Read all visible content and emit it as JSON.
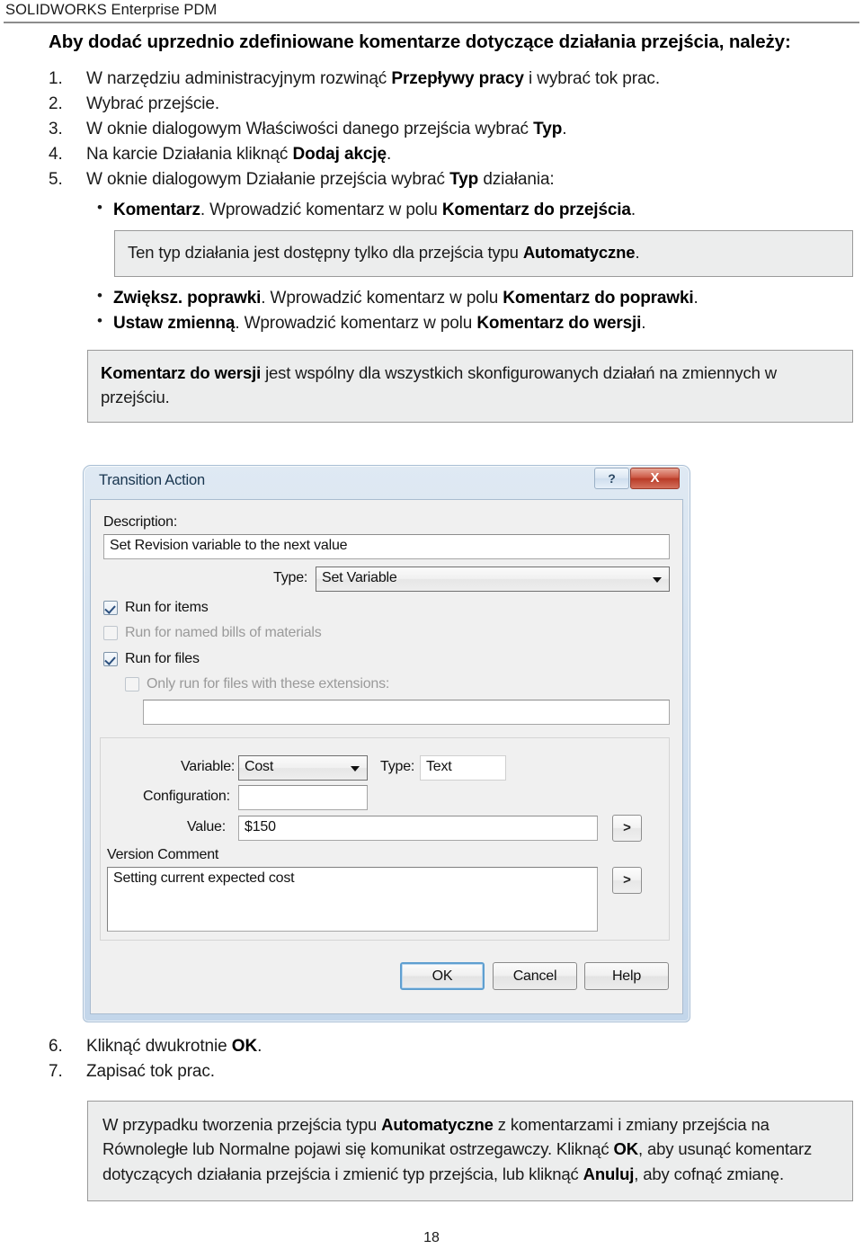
{
  "header": {
    "running_title": "SOLIDWORKS Enterprise PDM"
  },
  "heading": "Aby dodać uprzednio zdefiniowane komentarze dotyczące działania przejścia, należy:",
  "steps": [
    {
      "num": "1.",
      "html": "W narzędziu administracyjnym rozwinąć <b>Przepływy pracy</b> i wybrać tok prac."
    },
    {
      "num": "2.",
      "html": "Wybrać przejście."
    },
    {
      "num": "3.",
      "html": "W oknie dialogowym Właściwości danego przejścia wybrać <b>Typ</b>."
    },
    {
      "num": "4.",
      "html": "Na karcie Działania kliknąć <b>Dodaj akcję</b>."
    },
    {
      "num": "5.",
      "html": "W oknie dialogowym Działanie przejścia wybrać <b>Typ</b> działania:"
    }
  ],
  "bullets_group_1": [
    {
      "bullet": "•",
      "html": "<b>Komentarz</b>. Wprowadzić komentarz w polu <b>Komentarz do przejścia</b>."
    }
  ],
  "note_1": "Ten typ działania jest dostępny tylko dla przejścia typu <b>Automatyczne</b>.",
  "bullets_group_2": [
    {
      "bullet": "•",
      "html": "<b>Zwiększ. poprawki</b>. Wprowadzić komentarz w polu <b>Komentarz do poprawki</b>."
    },
    {
      "bullet": "•",
      "html": "<b>Ustaw zmienną</b>. Wprowadzić komentarz w polu <b>Komentarz do wersji</b>."
    }
  ],
  "note_2": "<b>Komentarz do wersji</b> jest wspólny dla wszystkich skonfigurowanych działań na zmiennych w przejściu.",
  "dialog": {
    "title": "Transition Action",
    "help_button_glyph": "?",
    "close_button_glyph": "X",
    "description_label": "Description:",
    "description_value": "Set Revision variable to the next value",
    "type_label": "Type:",
    "type_value": "Set Variable",
    "checkbox_run_items_label": "Run for items",
    "checkbox_run_items_checked": true,
    "checkbox_run_bom_label": "Run for named bills of materials",
    "checkbox_run_bom_checked": false,
    "checkbox_run_files_label": "Run for files",
    "checkbox_run_files_checked": true,
    "checkbox_extensions_label": "Only run for files with these extensions:",
    "checkbox_extensions_checked": false,
    "extensions_value": "",
    "variable_label": "Variable:",
    "variable_value": "Cost",
    "var_type_label": "Type:",
    "var_type_value": "Text",
    "configuration_label": "Configuration:",
    "configuration_value": "",
    "value_label": "Value:",
    "value_value": "$150",
    "value_expand_glyph": ">",
    "version_comment_label": "Version Comment",
    "version_comment_value": "Setting current expected cost",
    "version_comment_expand_glyph": ">",
    "ok_label": "OK",
    "cancel_label": "Cancel",
    "help_label": "Help"
  },
  "steps_bottom": [
    {
      "num": "6.",
      "html": "Kliknąć dwukrotnie <b>OK</b>."
    },
    {
      "num": "7.",
      "html": "Zapisać tok prac."
    }
  ],
  "note_3": "W przypadku tworzenia przejścia typu <b>Automatyczne</b> z komentarzami i zmiany przejścia na Równoległe lub Normalne pojawi się komunikat ostrzegawczy. Kliknąć <b>OK</b>, aby usunąć komentarz dotyczących działania przejścia i zmienić typ przejścia, lub kliknąć <b>Anuluj</b>, aby cofnąć zmianę.",
  "page_number": "18",
  "colors": {
    "note_background": "#eceded",
    "note_border": "#9a9a9a",
    "dialog_title_text": "#18354f",
    "close_button": "#b93b27",
    "default_button_outline": "#5f9fd0"
  }
}
